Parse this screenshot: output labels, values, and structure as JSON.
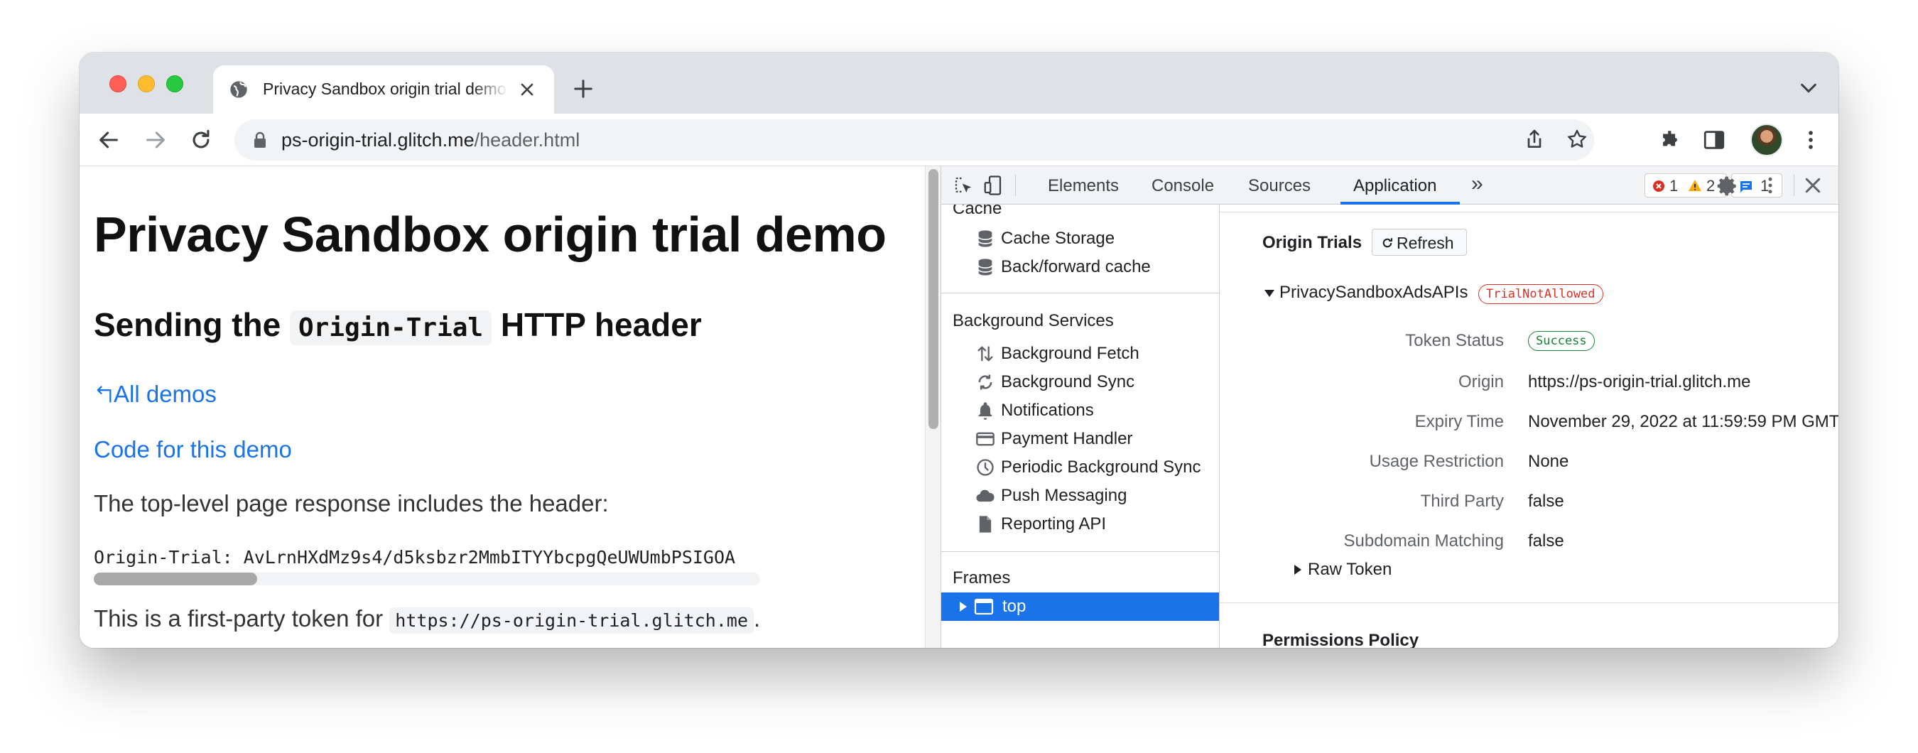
{
  "browser": {
    "tab_title": "Privacy Sandbox origin trial demo",
    "url_host": "ps-origin-trial.glitch.me",
    "url_path": "/header.html"
  },
  "page": {
    "heading": "Privacy Sandbox origin trial demo",
    "subheading_pre": "Sending the ",
    "subheading_code": "Origin-Trial",
    "subheading_post": " HTTP header",
    "link_all_demos": "All demos",
    "link_code": "Code for this demo",
    "para_response": "The top-level page response includes the header:",
    "header_line": "Origin-Trial: AvLrnHXdMz9s4/d5ksbzr2MmbITYYbcpgQeUWUmbPSIGOA",
    "para_token_pre": "This is a first-party token for ",
    "para_token_code": "https://ps-origin-trial.glitch.me",
    "para_token_post": "."
  },
  "devtools": {
    "tabs": [
      "Elements",
      "Console",
      "Sources",
      "Application"
    ],
    "active_tab": "Application",
    "more_tabs": "»",
    "error_count": "1",
    "warning_count": "2",
    "message_count": "1",
    "sidebar": {
      "cache_heading": "Cache",
      "cache_items": [
        "Cache Storage",
        "Back/forward cache"
      ],
      "bg_heading": "Background Services",
      "bg_items": [
        "Background Fetch",
        "Background Sync",
        "Notifications",
        "Payment Handler",
        "Periodic Background Sync",
        "Push Messaging",
        "Reporting API"
      ],
      "frames_heading": "Frames",
      "frame_top": "top"
    },
    "origin_trials": {
      "title": "Origin Trials",
      "refresh_label": "Refresh",
      "trial_name": "PrivacySandboxAdsAPIs",
      "trial_status": "TrialNotAllowed",
      "properties": {
        "token_status_label": "Token Status",
        "token_status_value": "Success",
        "origin_label": "Origin",
        "origin_value": "https://ps-origin-trial.glitch.me",
        "expiry_label": "Expiry Time",
        "expiry_value": "November 29, 2022 at 11:59:59 PM GMT",
        "usage_label": "Usage Restriction",
        "usage_value": "None",
        "third_party_label": "Third Party",
        "third_party_value": "false",
        "subdomain_label": "Subdomain Matching",
        "subdomain_value": "false"
      },
      "raw_token_label": "Raw Token"
    },
    "permissions_title": "Permissions Policy"
  },
  "colors": {
    "link": "#1a73e8",
    "accent": "#1a73e8",
    "error_red": "#d93025",
    "success_green": "#188038"
  }
}
